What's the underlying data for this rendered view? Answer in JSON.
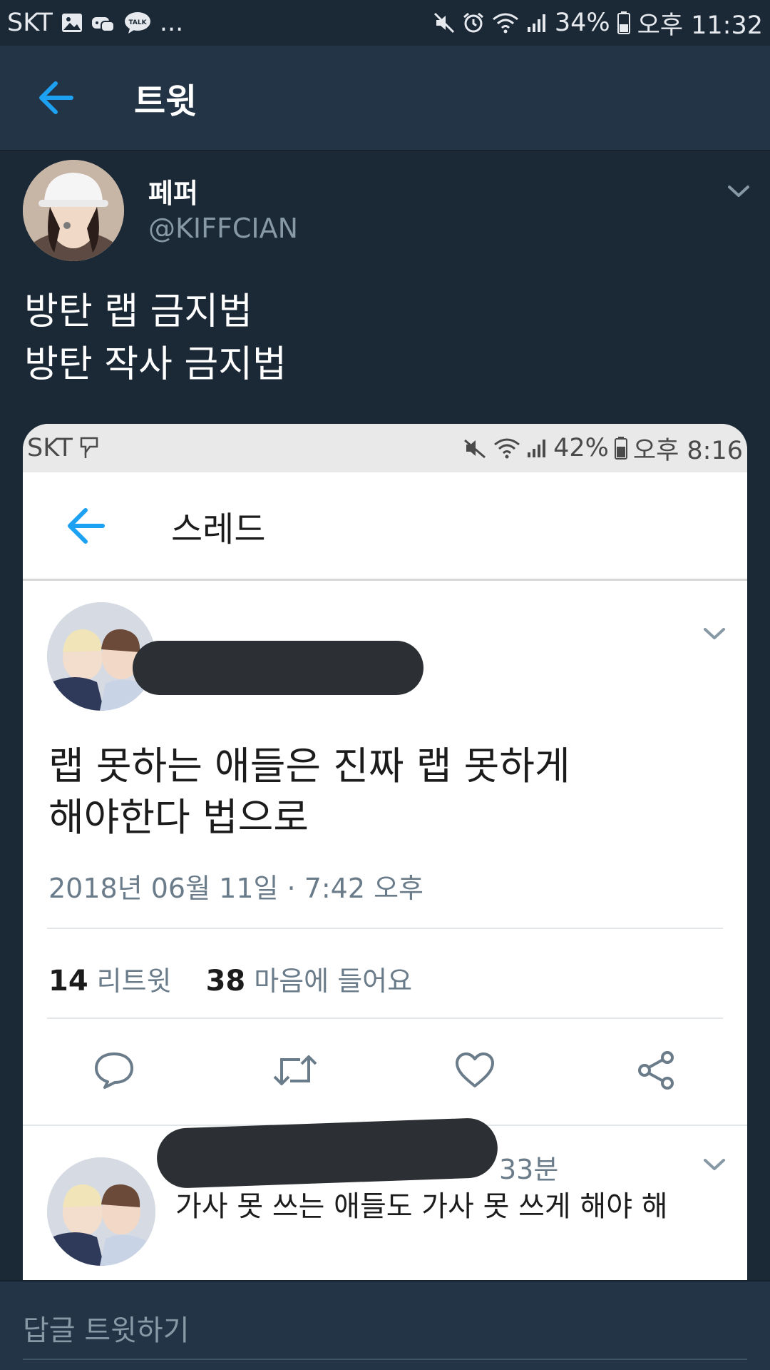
{
  "status_bar": {
    "carrier": "SKT",
    "notif_overflow": "...",
    "talk_label": "TALK",
    "battery": "34%",
    "time": "오후 11:32"
  },
  "header": {
    "title": "트윗"
  },
  "tweet": {
    "display_name": "페퍼",
    "handle": "@KIFFCIAN",
    "text_lines": [
      "방탄 랩 금지법",
      "방탄 작사 금지법"
    ]
  },
  "embedded": {
    "status_bar": {
      "carrier": "SKT",
      "battery": "42%",
      "time": "오후 8:16"
    },
    "header": {
      "title": "스레드"
    },
    "tweet": {
      "text_lines": [
        "랩 못하는 애들은 진짜 랩 못하게",
        "해야한다 법으로"
      ],
      "date": "2018년 06월 11일 · 7:42 오후",
      "retweets": "14",
      "retweets_label": "리트윗",
      "likes": "38",
      "likes_label": "마음에 들어요"
    },
    "reply": {
      "time": "33분",
      "text": "가사 못 쓰는 애들도 가사 못 쓰게 해야 해"
    }
  },
  "reply_bar": {
    "placeholder": "답글 트윗하기"
  },
  "colors": {
    "background": "#1b2836",
    "header": "#243447",
    "accent": "#1da1f2",
    "secondary_text": "#8899a6"
  }
}
